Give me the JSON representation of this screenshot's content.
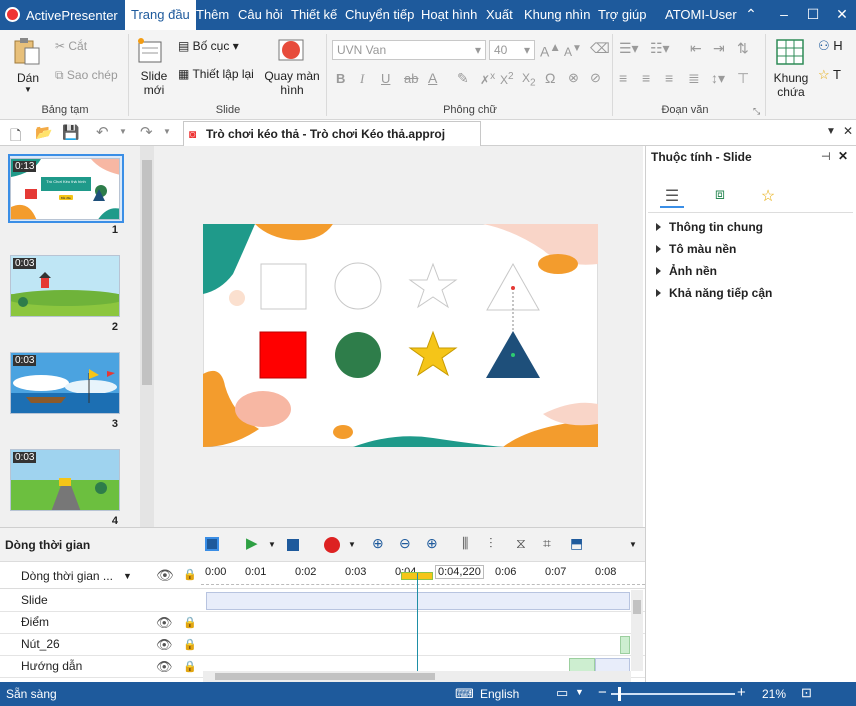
{
  "app": {
    "name": "ActivePresenter",
    "user": "ATOMI-User"
  },
  "menu": {
    "tabs": [
      "Trang đầu",
      "Thêm",
      "Câu hỏi",
      "Thiết kế",
      "Chuyển tiếp",
      "Hoạt hình",
      "Xuất",
      "Khung nhìn",
      "Trợ giúp"
    ],
    "active": 0
  },
  "ribbon": {
    "paste_label": "Dán",
    "cut_label": "Cắt",
    "copy_label": "Sao chép",
    "clipboard_group": "Bảng tạm",
    "new_slide_label": "Slide mới",
    "layout_label": "Bố cục",
    "reset_label": "Thiết lập lại",
    "screen_label": "Quay màn hình",
    "slide_group": "Slide",
    "font_name": "UVN Van",
    "font_size": "40",
    "font_group": "Phông chữ",
    "paragraph_group": "Đoạn văn",
    "frame_label": "Khung chứa",
    "overflow_h": "H",
    "overflow_t": "T"
  },
  "document": {
    "tab_title": "Trò chơi kéo thả  - Trò chơi Kéo thả.approj"
  },
  "slides": [
    {
      "duration": "0:13",
      "number": "1",
      "title": "Trò Chơi Kéo thả hình",
      "button": "Bắt đầu"
    },
    {
      "duration": "0:03",
      "number": "2"
    },
    {
      "duration": "0:03",
      "number": "3"
    },
    {
      "duration": "0:03",
      "number": "4"
    }
  ],
  "properties": {
    "title": "Thuộc tính - Slide",
    "sections": [
      "Thông tin chung",
      "Tô màu nền",
      "Ảnh nền",
      "Khả năng tiếp cận"
    ]
  },
  "timeline": {
    "title": "Dòng thời gian",
    "dropdown": "Dòng thời gian ...",
    "ruler": [
      "0:00",
      "0:01",
      "0:02",
      "0:03",
      "0:04",
      "0:06",
      "0:07",
      "0:08"
    ],
    "playhead": "0:04,220",
    "rows": [
      "Slide",
      "Điểm",
      "Nút_26",
      "Hướng dẫn"
    ]
  },
  "status": {
    "text": "Sẵn sàng",
    "language": "English",
    "zoom": "21%"
  },
  "colors": {
    "brand": "#1e5a9c",
    "shape_red": "#ff0000",
    "shape_green": "#2e7d4a",
    "shape_yellow": "#f5c518",
    "shape_blue": "#1e4f7a"
  }
}
